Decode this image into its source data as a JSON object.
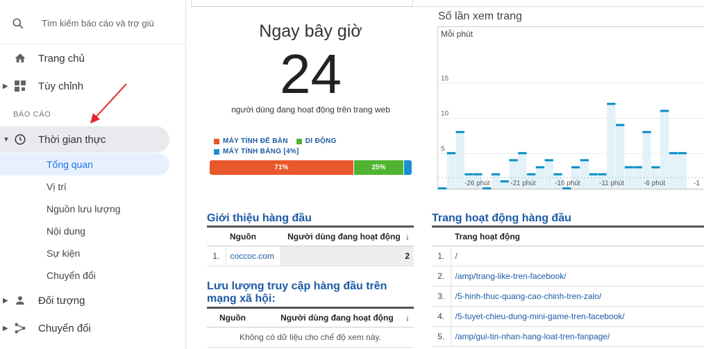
{
  "search": {
    "placeholder": "Tìm kiếm báo cáo và trợ giú"
  },
  "nav": {
    "home": "Trang chủ",
    "customize": "Tùy chỉnh",
    "section_reports": "BÁO CÁO",
    "realtime": "Thời gian thực",
    "realtime_sub": [
      "Tổng quan",
      "Vị trí",
      "Nguồn lưu lượng",
      "Nội dung",
      "Sự kiện",
      "Chuyển đổi"
    ],
    "audience": "Đối tượng",
    "acquisition": "Chuyển đổi"
  },
  "realtime": {
    "title": "Ngay bây giờ",
    "active_users": "24",
    "subtitle": "người dùng đang hoạt động trên trang web",
    "legend": [
      {
        "label": "MÁY TÍNH ĐỂ BÀN",
        "color": "#e8582a"
      },
      {
        "label": "DI ĐỘNG",
        "color": "#50b432"
      },
      {
        "label": "MÁY TÍNH BẢNG [4%]",
        "color": "#1a8fd1"
      }
    ],
    "devices": [
      {
        "name": "MÁY TÍNH ĐỂ BÀN",
        "percent": 71,
        "label": "71%",
        "color": "#e8582a"
      },
      {
        "name": "DI ĐỘNG",
        "percent": 25,
        "label": "25%",
        "color": "#50b432"
      },
      {
        "name": "MÁY TÍNH BẢNG",
        "percent": 4,
        "label": "",
        "color": "#1a8fd1"
      }
    ]
  },
  "pageviews": {
    "title": "Số lần xem trang",
    "subtitle": "Mỗi phút"
  },
  "chart_data": {
    "type": "bar",
    "title": "Số lần xem trang",
    "ylabel": "Mỗi phút",
    "ylim": [
      0,
      20
    ],
    "yticks": [
      "5",
      "10",
      "15"
    ],
    "xticks": [
      "-26 phút",
      "-21 phút",
      "-16 phút",
      "-11 phút",
      "-6 phút",
      "-1"
    ],
    "values": [
      0,
      5,
      8,
      2,
      2,
      0,
      2,
      1,
      4,
      5,
      2,
      3,
      4,
      2,
      0,
      3,
      4,
      2,
      2,
      12,
      9,
      3,
      3,
      8,
      3,
      11,
      5,
      5
    ],
    "color": "#058dc7"
  },
  "top_referrals": {
    "title": "Giới thiệu hàng đầu",
    "col_source": "Nguồn",
    "col_users": "Người dùng đang hoạt động",
    "rows": [
      {
        "n": "1.",
        "source": "coccoc.com",
        "users": "2"
      }
    ]
  },
  "top_social": {
    "title": "Lưu lượng truy cập hàng đầu trên mạng xã hội:",
    "col_source": "Nguồn",
    "col_users": "Người dùng đang hoạt động",
    "empty": "Không có dữ liệu cho chế độ xem này."
  },
  "top_pages": {
    "title": "Trang hoạt động hàng đầu",
    "col_page": "Trang hoạt động",
    "rows": [
      {
        "n": "1.",
        "page": "/"
      },
      {
        "n": "2.",
        "page": "/amp/trang-like-tren-facebook/"
      },
      {
        "n": "3.",
        "page": "/5-hinh-thuc-quang-cao-chinh-tren-zalo/"
      },
      {
        "n": "4.",
        "page": "/5-tuyet-chieu-dung-mini-game-tren-facebook/"
      },
      {
        "n": "5.",
        "page": "/amp/gui-tin-nhan-hang-loat-tren-fanpage/"
      }
    ]
  },
  "sort_arrow": "↓"
}
